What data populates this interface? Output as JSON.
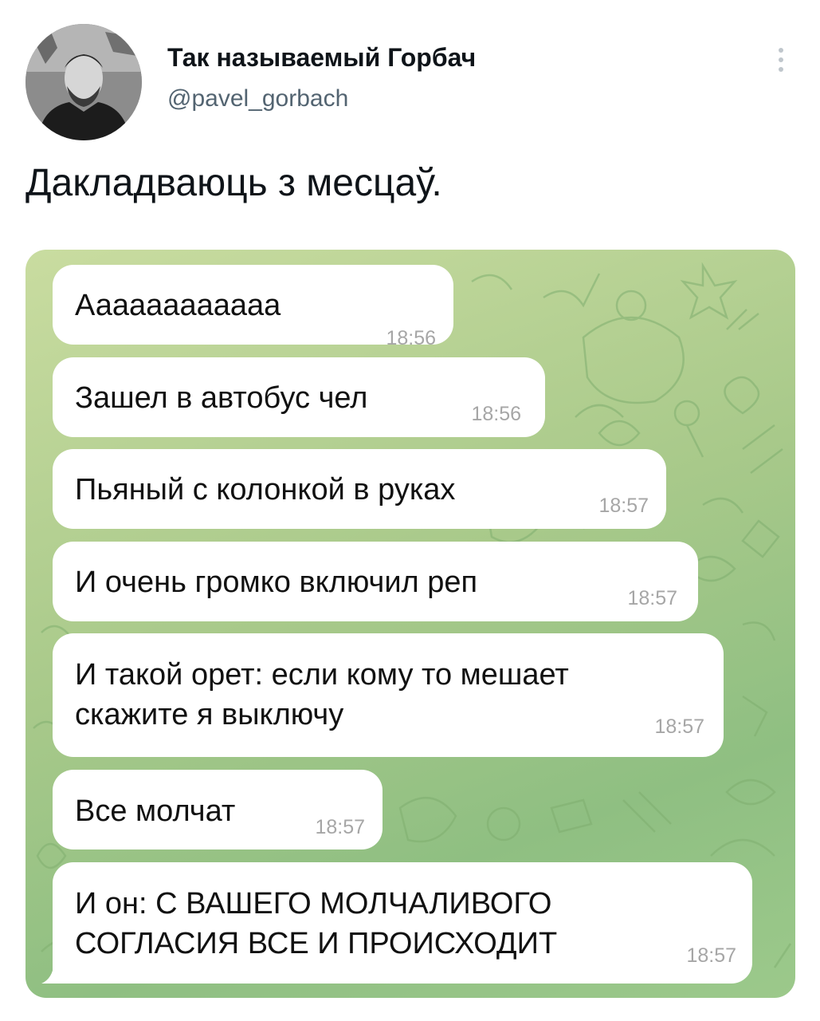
{
  "tweet": {
    "display_name": "Так называемый Горбач",
    "handle": "@pavel_gorbach",
    "text": "Дакладваюць з месцаў."
  },
  "messages": [
    {
      "text": "Аааааааааааа",
      "time": "18:56"
    },
    {
      "text": "Зашел в автобус чел",
      "time": "18:56"
    },
    {
      "text": "Пьяный с колонкой в руках",
      "time": "18:57"
    },
    {
      "text": "И очень громко включил реп",
      "time": "18:57"
    },
    {
      "line1": "И такой орет: если кому то мешает",
      "line2": "скажите я выключу",
      "time": "18:57"
    },
    {
      "text": "Все молчат",
      "time": "18:57"
    },
    {
      "line1": "И он: С ВАШЕГО МОЛЧАЛИВОГО",
      "line2": "СОГЛАСИЯ ВСЕ И ПРОИСХОДИТ",
      "time": "18:57"
    }
  ],
  "colors": {
    "chat_background": "#a8c98a",
    "bubble": "#ffffff",
    "timestamp": "#a6a6a6",
    "handle": "#536471"
  },
  "icons": [
    "more-vertical-icon",
    "avatar-photo"
  ]
}
